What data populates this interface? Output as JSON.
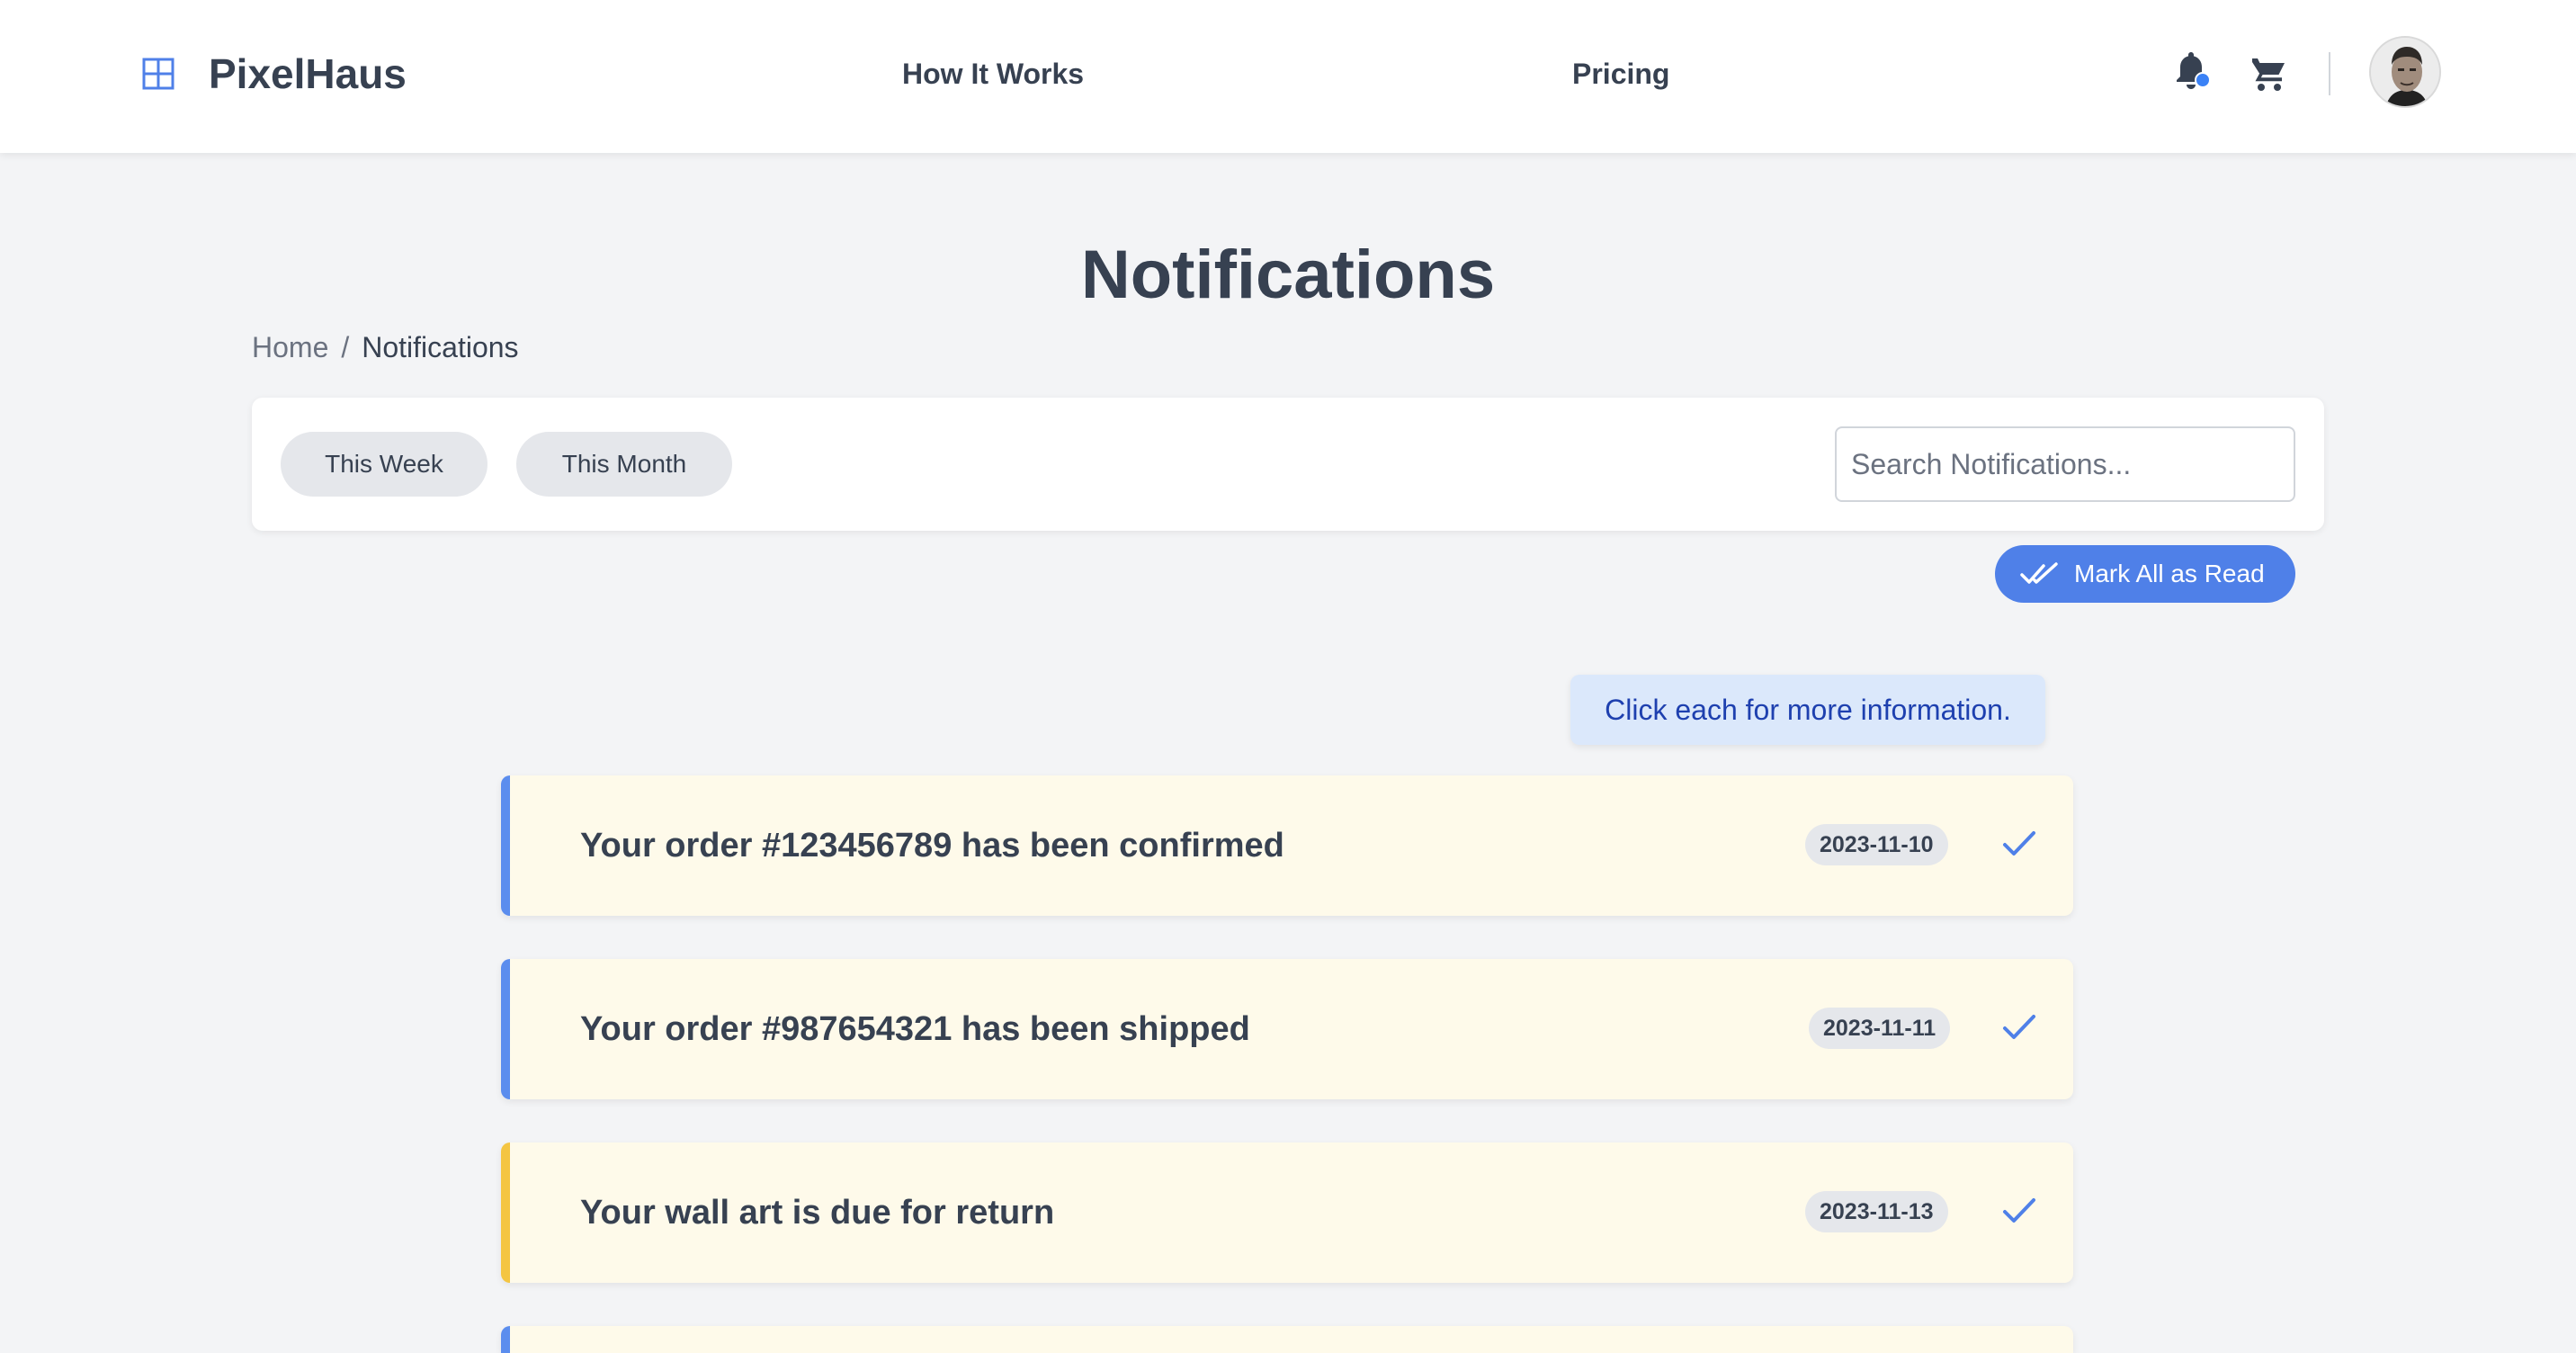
{
  "brand": {
    "name": "PixelHaus",
    "icon": "grid-icon"
  },
  "nav": {
    "links": [
      "How It Works",
      "Pricing"
    ]
  },
  "header_icons": [
    "bell-icon",
    "cart-icon",
    "avatar"
  ],
  "page": {
    "title": "Notifications"
  },
  "breadcrumb": {
    "home": "Home",
    "separator": "/",
    "current": "Notifications"
  },
  "filters": {
    "buttons": [
      "This Week",
      "This Month"
    ],
    "search_placeholder": "Search Notifications..."
  },
  "actions": {
    "mark_all": "Mark All as Read"
  },
  "hint": "Click each for more information.",
  "notifications": [
    {
      "text": "Your order #123456789 has been confirmed",
      "date": "2023-11-10",
      "accent": "#5b8dee"
    },
    {
      "text": "Your order #987654321 has been shipped",
      "date": "2023-11-11",
      "accent": "#5b8dee"
    },
    {
      "text": "Your wall art is due for return",
      "date": "2023-11-13",
      "accent": "#f4c542"
    },
    {
      "text": "",
      "date": "",
      "accent": "#5b8dee"
    }
  ],
  "colors": {
    "primary": "#4f80e8",
    "accent_blue": "#5b8dee",
    "accent_yellow": "#f4c542",
    "card_bg": "#fefaea",
    "page_bg": "#f3f4f6"
  }
}
